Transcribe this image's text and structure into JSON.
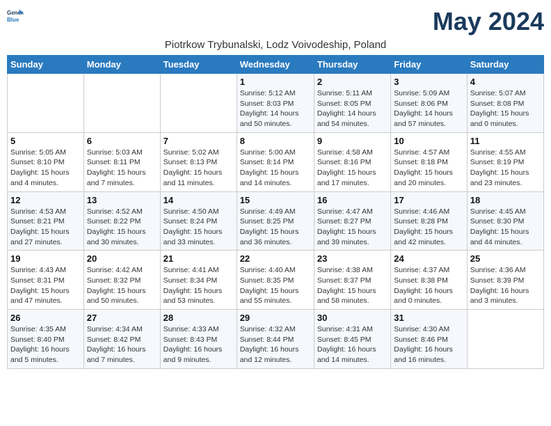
{
  "header": {
    "logo_general": "General",
    "logo_blue": "Blue",
    "month_title": "May 2024",
    "location": "Piotrkow Trybunalski, Lodz Voivodeship, Poland"
  },
  "weekdays": [
    "Sunday",
    "Monday",
    "Tuesday",
    "Wednesday",
    "Thursday",
    "Friday",
    "Saturday"
  ],
  "weeks": [
    [
      {
        "day": "",
        "info": ""
      },
      {
        "day": "",
        "info": ""
      },
      {
        "day": "",
        "info": ""
      },
      {
        "day": "1",
        "info": "Sunrise: 5:12 AM\nSunset: 8:03 PM\nDaylight: 14 hours\nand 50 minutes."
      },
      {
        "day": "2",
        "info": "Sunrise: 5:11 AM\nSunset: 8:05 PM\nDaylight: 14 hours\nand 54 minutes."
      },
      {
        "day": "3",
        "info": "Sunrise: 5:09 AM\nSunset: 8:06 PM\nDaylight: 14 hours\nand 57 minutes."
      },
      {
        "day": "4",
        "info": "Sunrise: 5:07 AM\nSunset: 8:08 PM\nDaylight: 15 hours\nand 0 minutes."
      }
    ],
    [
      {
        "day": "5",
        "info": "Sunrise: 5:05 AM\nSunset: 8:10 PM\nDaylight: 15 hours\nand 4 minutes."
      },
      {
        "day": "6",
        "info": "Sunrise: 5:03 AM\nSunset: 8:11 PM\nDaylight: 15 hours\nand 7 minutes."
      },
      {
        "day": "7",
        "info": "Sunrise: 5:02 AM\nSunset: 8:13 PM\nDaylight: 15 hours\nand 11 minutes."
      },
      {
        "day": "8",
        "info": "Sunrise: 5:00 AM\nSunset: 8:14 PM\nDaylight: 15 hours\nand 14 minutes."
      },
      {
        "day": "9",
        "info": "Sunrise: 4:58 AM\nSunset: 8:16 PM\nDaylight: 15 hours\nand 17 minutes."
      },
      {
        "day": "10",
        "info": "Sunrise: 4:57 AM\nSunset: 8:18 PM\nDaylight: 15 hours\nand 20 minutes."
      },
      {
        "day": "11",
        "info": "Sunrise: 4:55 AM\nSunset: 8:19 PM\nDaylight: 15 hours\nand 23 minutes."
      }
    ],
    [
      {
        "day": "12",
        "info": "Sunrise: 4:53 AM\nSunset: 8:21 PM\nDaylight: 15 hours\nand 27 minutes."
      },
      {
        "day": "13",
        "info": "Sunrise: 4:52 AM\nSunset: 8:22 PM\nDaylight: 15 hours\nand 30 minutes."
      },
      {
        "day": "14",
        "info": "Sunrise: 4:50 AM\nSunset: 8:24 PM\nDaylight: 15 hours\nand 33 minutes."
      },
      {
        "day": "15",
        "info": "Sunrise: 4:49 AM\nSunset: 8:25 PM\nDaylight: 15 hours\nand 36 minutes."
      },
      {
        "day": "16",
        "info": "Sunrise: 4:47 AM\nSunset: 8:27 PM\nDaylight: 15 hours\nand 39 minutes."
      },
      {
        "day": "17",
        "info": "Sunrise: 4:46 AM\nSunset: 8:28 PM\nDaylight: 15 hours\nand 42 minutes."
      },
      {
        "day": "18",
        "info": "Sunrise: 4:45 AM\nSunset: 8:30 PM\nDaylight: 15 hours\nand 44 minutes."
      }
    ],
    [
      {
        "day": "19",
        "info": "Sunrise: 4:43 AM\nSunset: 8:31 PM\nDaylight: 15 hours\nand 47 minutes."
      },
      {
        "day": "20",
        "info": "Sunrise: 4:42 AM\nSunset: 8:32 PM\nDaylight: 15 hours\nand 50 minutes."
      },
      {
        "day": "21",
        "info": "Sunrise: 4:41 AM\nSunset: 8:34 PM\nDaylight: 15 hours\nand 53 minutes."
      },
      {
        "day": "22",
        "info": "Sunrise: 4:40 AM\nSunset: 8:35 PM\nDaylight: 15 hours\nand 55 minutes."
      },
      {
        "day": "23",
        "info": "Sunrise: 4:38 AM\nSunset: 8:37 PM\nDaylight: 15 hours\nand 58 minutes."
      },
      {
        "day": "24",
        "info": "Sunrise: 4:37 AM\nSunset: 8:38 PM\nDaylight: 16 hours\nand 0 minutes."
      },
      {
        "day": "25",
        "info": "Sunrise: 4:36 AM\nSunset: 8:39 PM\nDaylight: 16 hours\nand 3 minutes."
      }
    ],
    [
      {
        "day": "26",
        "info": "Sunrise: 4:35 AM\nSunset: 8:40 PM\nDaylight: 16 hours\nand 5 minutes."
      },
      {
        "day": "27",
        "info": "Sunrise: 4:34 AM\nSunset: 8:42 PM\nDaylight: 16 hours\nand 7 minutes."
      },
      {
        "day": "28",
        "info": "Sunrise: 4:33 AM\nSunset: 8:43 PM\nDaylight: 16 hours\nand 9 minutes."
      },
      {
        "day": "29",
        "info": "Sunrise: 4:32 AM\nSunset: 8:44 PM\nDaylight: 16 hours\nand 12 minutes."
      },
      {
        "day": "30",
        "info": "Sunrise: 4:31 AM\nSunset: 8:45 PM\nDaylight: 16 hours\nand 14 minutes."
      },
      {
        "day": "31",
        "info": "Sunrise: 4:30 AM\nSunset: 8:46 PM\nDaylight: 16 hours\nand 16 minutes."
      },
      {
        "day": "",
        "info": ""
      }
    ]
  ]
}
